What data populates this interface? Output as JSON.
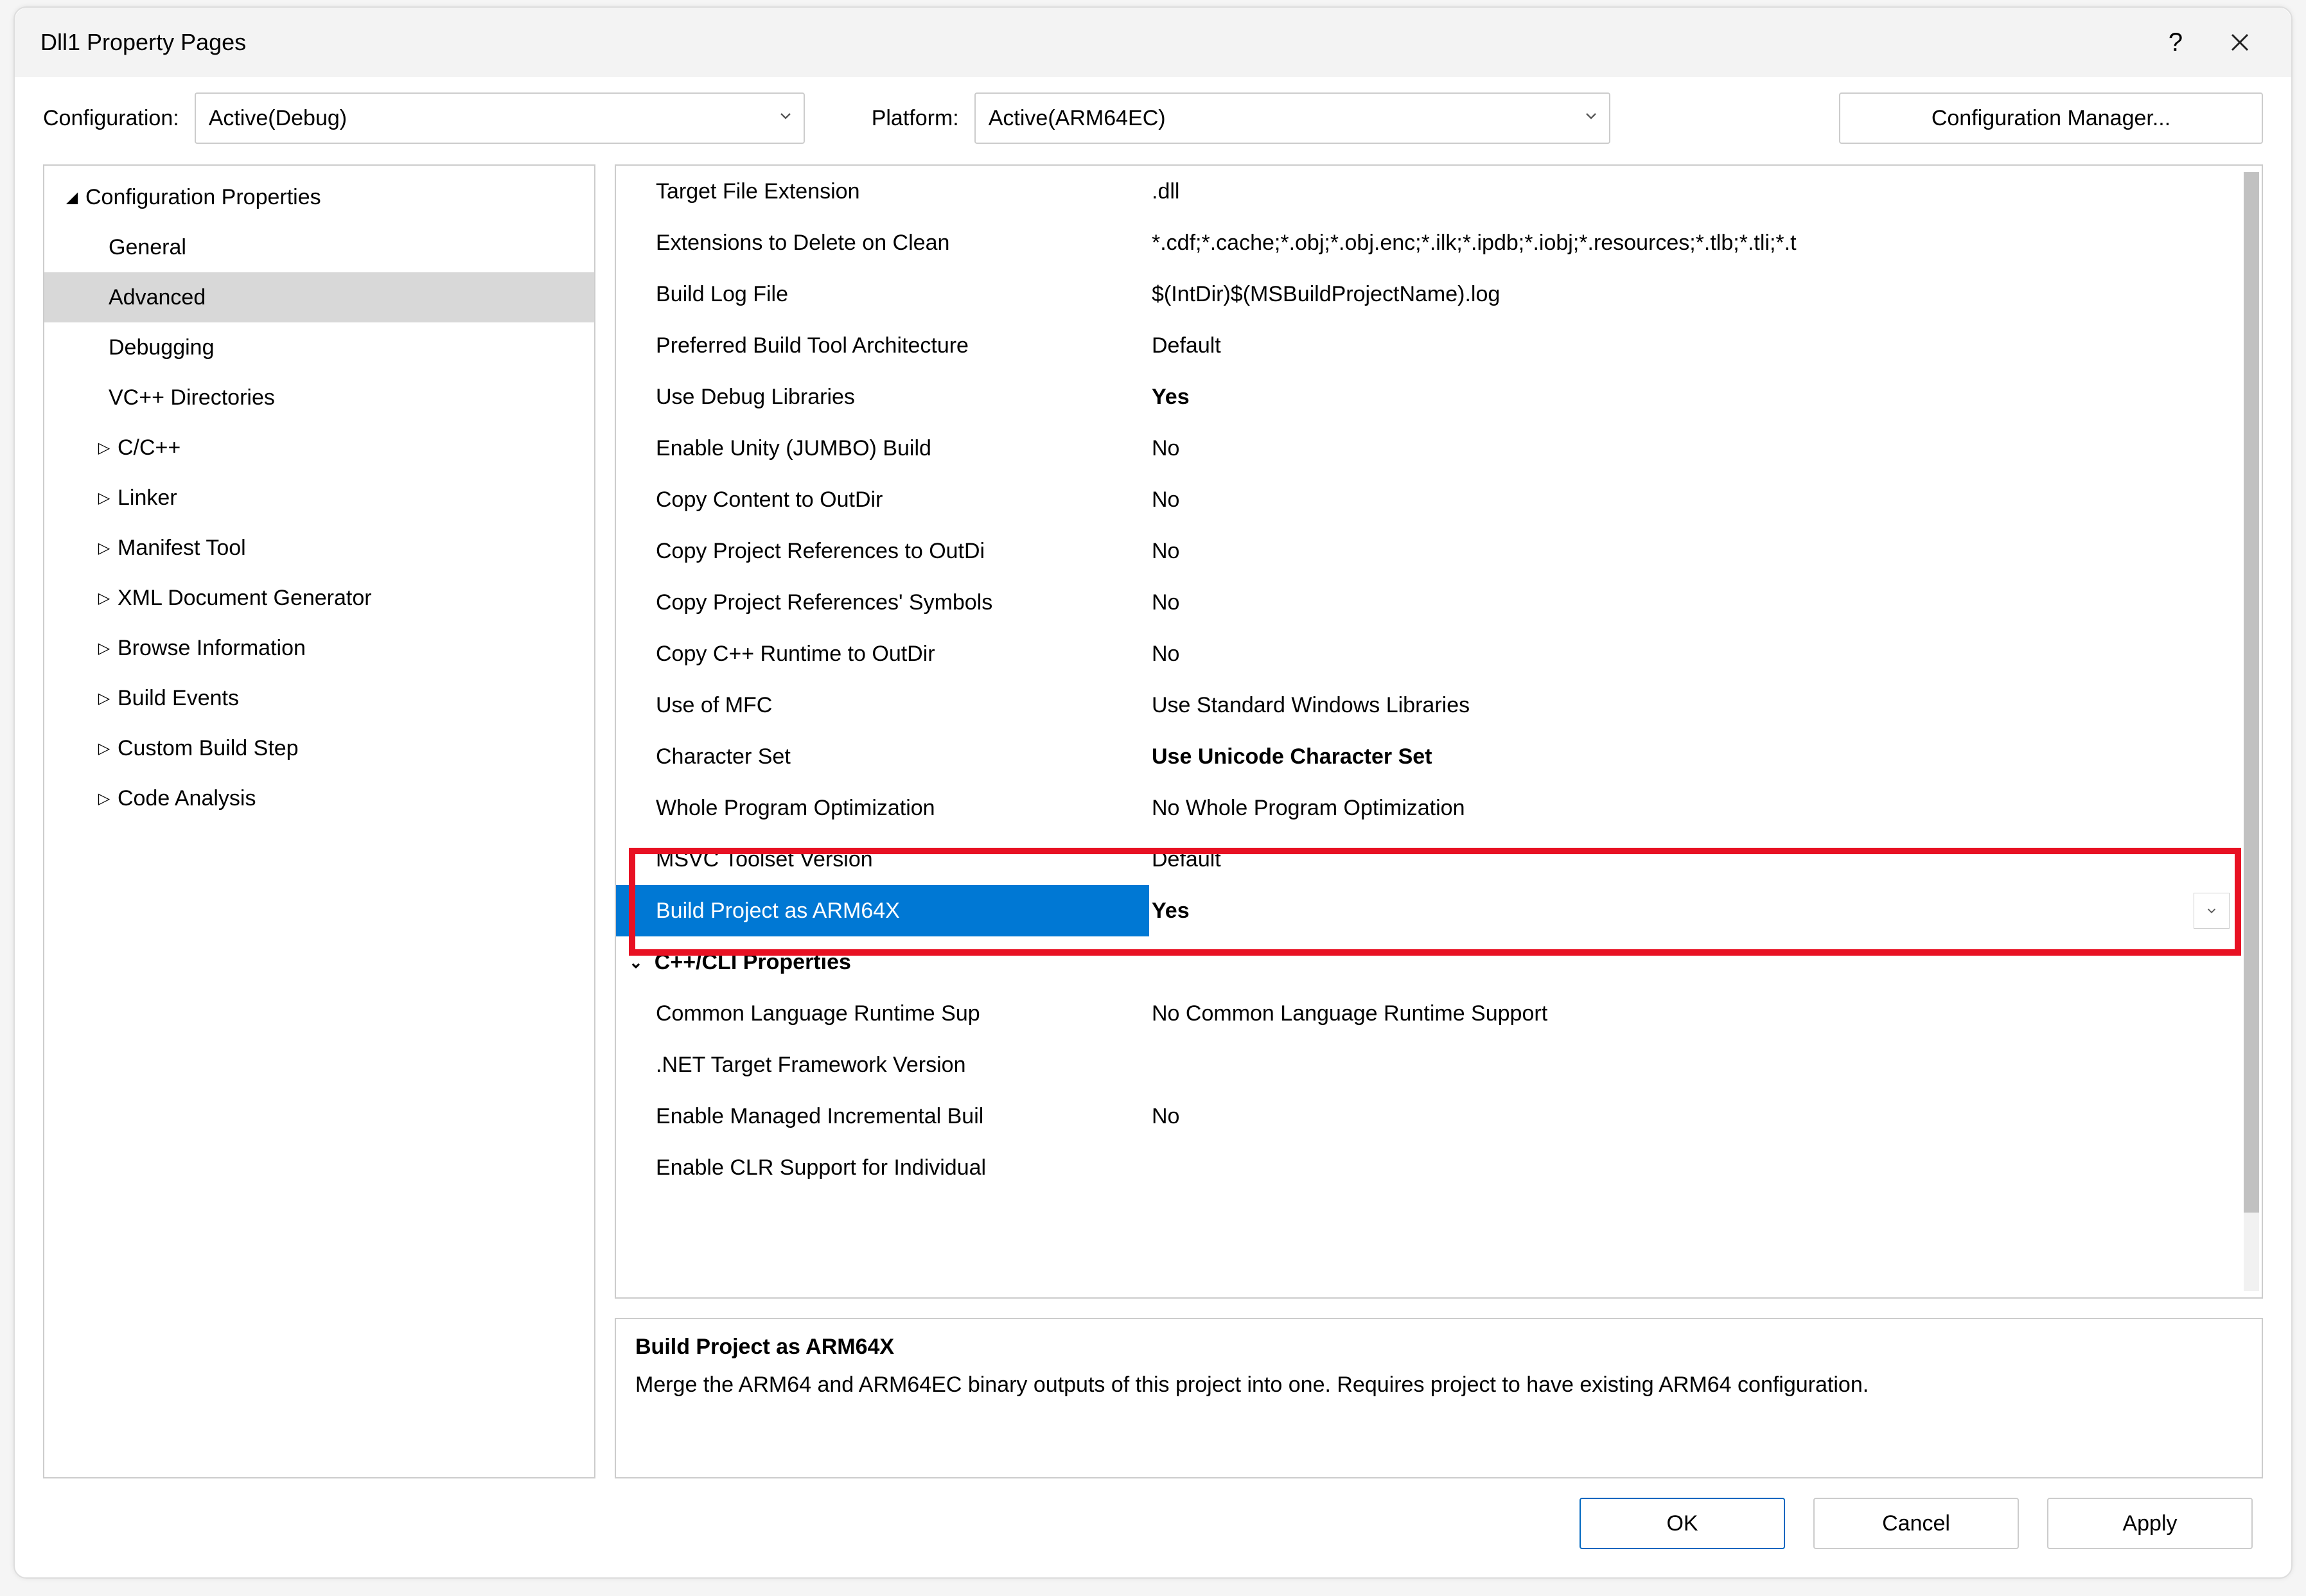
{
  "window": {
    "title": "Dll1 Property Pages"
  },
  "configRow": {
    "configLabel": "Configuration:",
    "configValue": "Active(Debug)",
    "platformLabel": "Platform:",
    "platformValue": "Active(ARM64EC)",
    "managerBtn": "Configuration Manager..."
  },
  "tree": {
    "root": "Configuration Properties",
    "items": [
      {
        "label": "General",
        "level": 2
      },
      {
        "label": "Advanced",
        "level": 2,
        "selected": true
      },
      {
        "label": "Debugging",
        "level": 2
      },
      {
        "label": "VC++ Directories",
        "level": 2
      },
      {
        "label": "C/C++",
        "level": 2,
        "exp": true
      },
      {
        "label": "Linker",
        "level": 2,
        "exp": true
      },
      {
        "label": "Manifest Tool",
        "level": 2,
        "exp": true
      },
      {
        "label": "XML Document Generator",
        "level": 2,
        "exp": true
      },
      {
        "label": "Browse Information",
        "level": 2,
        "exp": true
      },
      {
        "label": "Build Events",
        "level": 2,
        "exp": true
      },
      {
        "label": "Custom Build Step",
        "level": 2,
        "exp": true
      },
      {
        "label": "Code Analysis",
        "level": 2,
        "exp": true
      }
    ]
  },
  "grid": {
    "rows": [
      {
        "name": "Target File Extension",
        "value": ".dll"
      },
      {
        "name": "Extensions to Delete on Clean",
        "value": "*.cdf;*.cache;*.obj;*.obj.enc;*.ilk;*.ipdb;*.iobj;*.resources;*.tlb;*.tli;*.t"
      },
      {
        "name": "Build Log File",
        "value": "$(IntDir)$(MSBuildProjectName).log"
      },
      {
        "name": "Preferred Build Tool Architecture",
        "value": "Default"
      },
      {
        "name": "Use Debug Libraries",
        "value": "Yes",
        "bold": true
      },
      {
        "name": "Enable Unity (JUMBO) Build",
        "value": "No"
      },
      {
        "name": "Copy Content to OutDir",
        "value": "No"
      },
      {
        "name": "Copy Project References to OutDi",
        "value": "No"
      },
      {
        "name": "Copy Project References' Symbols",
        "value": "No"
      },
      {
        "name": "Copy C++ Runtime to OutDir",
        "value": "No"
      },
      {
        "name": "Use of MFC",
        "value": "Use Standard Windows Libraries"
      },
      {
        "name": "Character Set",
        "value": "Use Unicode Character Set",
        "bold": true
      },
      {
        "name": "Whole Program Optimization",
        "value": "No Whole Program Optimization"
      },
      {
        "name": "MSVC Toolset Version",
        "value": "Default"
      },
      {
        "name": "Build Project as ARM64X",
        "value": "Yes",
        "bold": true,
        "selected": true
      }
    ],
    "group": "C++/CLI Properties",
    "rows2": [
      {
        "name": "Common Language Runtime Sup",
        "value": "No Common Language Runtime Support"
      },
      {
        "name": ".NET Target Framework Version",
        "value": ""
      },
      {
        "name": "Enable Managed Incremental Buil",
        "value": "No"
      },
      {
        "name": "Enable CLR Support for Individual",
        "value": ""
      }
    ]
  },
  "desc": {
    "title": "Build Project as ARM64X",
    "text": "Merge the ARM64 and ARM64EC binary outputs of this project into one. Requires project to have existing ARM64 configuration."
  },
  "footer": {
    "ok": "OK",
    "cancel": "Cancel",
    "apply": "Apply"
  }
}
